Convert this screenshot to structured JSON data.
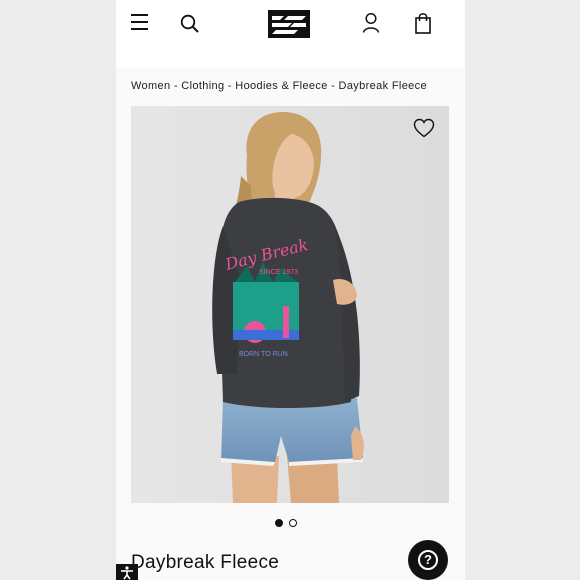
{
  "breadcrumb": {
    "items": [
      "Women",
      "Clothing",
      "Hoodies & Fleece",
      "Daybreak Fleece"
    ],
    "separator": " - "
  },
  "product": {
    "title": "Daybreak Fleece",
    "graphic_script": "Day Break",
    "graphic_since": "SINCE 1973",
    "graphic_bottom": "BORN TO RUN"
  },
  "gallery": {
    "total_images": 2,
    "active_index": 1
  },
  "icons": {
    "menu": "menu-icon",
    "search": "search-icon",
    "logo": "billabong-logo-icon",
    "account": "account-icon",
    "bag": "shopping-bag-icon",
    "wishlist": "heart-icon",
    "help": "help-icon",
    "accessibility": "accessibility-icon"
  },
  "colors": {
    "header_bg": "#ffffff",
    "page_bg": "#fafafa",
    "accent": "#111111",
    "sweatshirt": "#3d3e41",
    "graphic_pink": "#e8559a",
    "graphic_teal": "#1e9f8a"
  }
}
